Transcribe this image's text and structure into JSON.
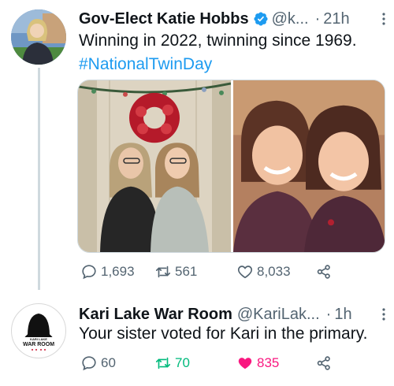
{
  "thread": [
    {
      "author_name": "Gov-Elect Katie Hobbs",
      "handle": "@k...",
      "separator": "·",
      "time": "21h",
      "text": "Winning in 2022, twinning since 1969.",
      "hashtag": "#NationalTwinDay",
      "replies": "1,693",
      "retweets": "561",
      "likes": "8,033",
      "verified": true
    },
    {
      "author_name": "Kari Lake War Room",
      "handle": "@KariLak...",
      "separator": "·",
      "time": "1h",
      "text": "Your sister voted for Kari in the primary.",
      "replies": "60",
      "retweets": "70",
      "likes": "835",
      "liked": true,
      "retweeted_color": "#00ba7c",
      "liked_color": "#f91880",
      "avatar_lines": [
        "KARI LAKE",
        "WAR ROOM"
      ]
    }
  ],
  "colors": {
    "link": "#1d9bf0",
    "secondary": "#536471",
    "verified": "#1d9bf0",
    "thread_line": "#cfd9de"
  }
}
